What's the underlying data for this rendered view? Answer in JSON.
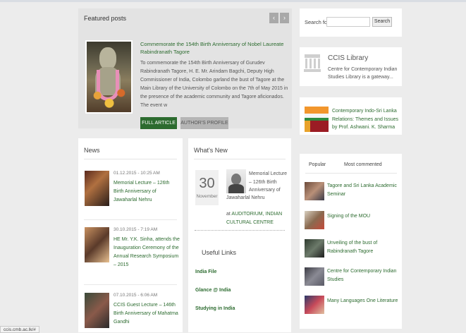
{
  "featured": {
    "title": "Featured posts",
    "prev": "‹",
    "next": "›",
    "headline": "Commemorate the 154th Birth Anniversary of Nobel Laureate Rabindranath Tagore",
    "excerpt": "To commemorate the 154th Birth Anniversary of Gurudev Rabindranath Tagore, H. E. Mr. Arindam Bagchi, Deputy High Commissioner of India, Colombo garland the bust of Tagore at the Main Library of the University of Colombo on the 7th of May 2015 in the presence of the academic community and Tagore aficionados. The event w",
    "full_article": "FULL ARTICLE",
    "author_profile": "AUTHOR'S PROFILE"
  },
  "search": {
    "label": "Search for:",
    "value": "",
    "button": "Search"
  },
  "library": {
    "title": "CCIS Library",
    "desc": "Centre for Contemporary Indian Studies Library is a gateway..."
  },
  "relations": {
    "text": "Contemporary Indo-Sri Lanka Relations: Themes and Issues by Prof. Ashwani. K. Sharma"
  },
  "popular": {
    "tabs": [
      "Popular",
      "Most commented"
    ],
    "items": [
      "Tagore and Sri Lanka Academic Seminar",
      "Signing of the MOU",
      "Unveiling of the bust of Rabindranath Tagore",
      "Centre for Contemporary Indian Studies",
      "Many Languages One Literature"
    ]
  },
  "news": {
    "title": "News",
    "items": [
      {
        "date": "01.12.2015 - 10:25 AM",
        "title": "Memorial Lecture – 126th Birth Anniversary of Jawaharlal Nehru"
      },
      {
        "date": "30.10.2015 - 7:19 AM",
        "title": "HE Mr. Y.K. Sinha, attends the Inauguration Ceremony of the Annual Research Symposium – 2015"
      },
      {
        "date": "07.10.2015 - 6:06 AM",
        "title": "CCIS Guest Lecture – 146th Birth Anniversary of Mahatma Gandhi"
      }
    ]
  },
  "whatsnew": {
    "title": "What's New",
    "day": "30",
    "month": "November",
    "event_title_a": "Memorial Lecture – 126th Birth Anniversary of",
    "event_title_b": "Jawaharlal Nehru",
    "at_prefix": "at",
    "venue": "AUDITORIUM, INDIAN CULTURAL CENTRE",
    "useful_links_title": "Useful Links",
    "links": [
      "India File",
      "Glance @ India",
      "Studying in India"
    ]
  },
  "status_url": "ccis.cmb.ac.lk/#"
}
